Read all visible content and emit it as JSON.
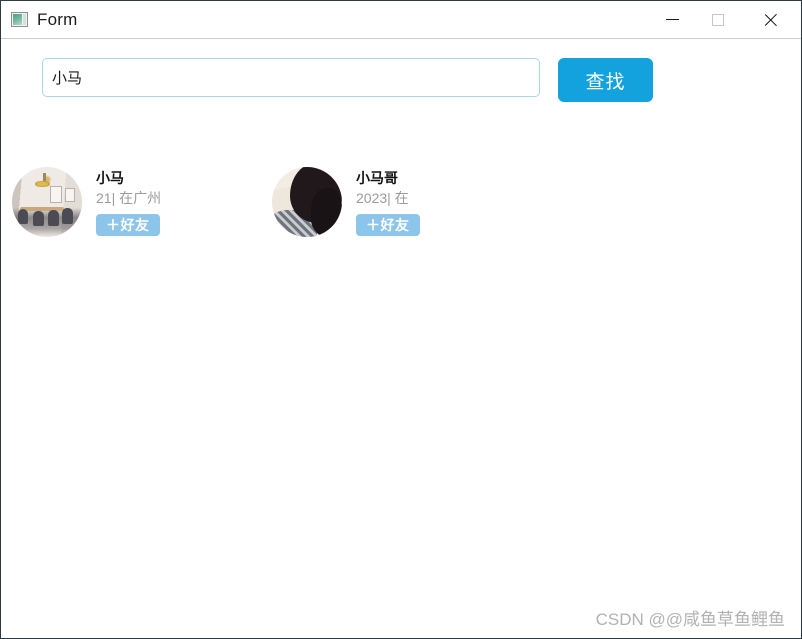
{
  "window": {
    "title": "Form",
    "icon": "image-app-icon",
    "controls": {
      "minimize": "minimize-icon",
      "maximize": "maximize-icon",
      "close": "close-icon"
    }
  },
  "search": {
    "value": "小马",
    "placeholder": "",
    "button_label": "查找"
  },
  "results": [
    {
      "name": "小马",
      "meta": "21| 在广州",
      "avatar": "room-photo",
      "action_label": "＋好友"
    },
    {
      "name": "小马哥",
      "meta": "2023| 在",
      "avatar": "portrait-photo",
      "action_label": "＋好友"
    }
  ],
  "watermark": "CSDN @@咸鱼草鱼鲤鱼",
  "colors": {
    "primary_button": "#13a2de",
    "friend_button": "#8dc4ea",
    "input_border": "#a6d5ee",
    "meta_text": "#9b9b9b",
    "watermark_text": "#b2b2b2"
  }
}
